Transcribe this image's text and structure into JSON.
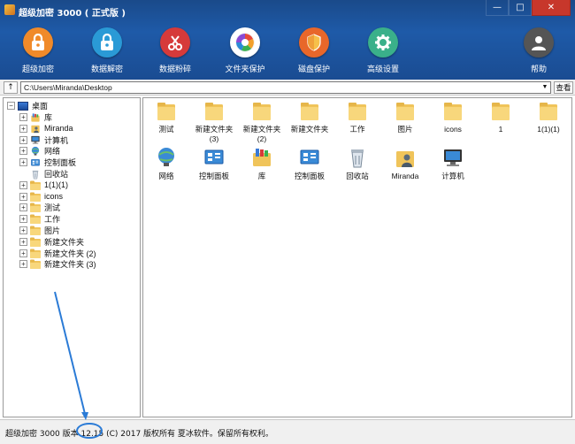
{
  "window": {
    "title": "超级加密 3000 ( 正式版 )",
    "controls": [
      "—",
      "□",
      "✕"
    ]
  },
  "toolbar": {
    "items": [
      {
        "label": "超级加密",
        "icon": "lock-icon",
        "color": "#f08a2a"
      },
      {
        "label": "数据解密",
        "icon": "unlock-icon",
        "color": "#2a9ad6"
      },
      {
        "label": "数据粉碎",
        "icon": "scissors-icon",
        "color": "#d63a3a"
      },
      {
        "label": "文件夹保护",
        "icon": "pinwheel-icon",
        "color": "#ffffff"
      },
      {
        "label": "磁盘保护",
        "icon": "shield-icon",
        "color": "#e8672a"
      },
      {
        "label": "高级设置",
        "icon": "gear-icon",
        "color": "#3ab08a"
      },
      {
        "label": "帮助",
        "icon": "user-icon",
        "color": "#555555"
      }
    ]
  },
  "addressbar": {
    "up_label": "↑",
    "path": "C:\\Users\\Miranda\\Desktop",
    "view_label": "查看"
  },
  "tree": {
    "root": "桌面",
    "items": [
      {
        "label": "库",
        "icon": "library-icon",
        "expandable": true
      },
      {
        "label": "Miranda",
        "icon": "user-folder-icon",
        "expandable": true
      },
      {
        "label": "计算机",
        "icon": "computer-icon",
        "expandable": true
      },
      {
        "label": "网络",
        "icon": "network-icon",
        "expandable": true
      },
      {
        "label": "控制面板",
        "icon": "control-panel-icon",
        "expandable": true
      },
      {
        "label": "回收站",
        "icon": "recycle-bin-icon",
        "expandable": false
      },
      {
        "label": "1(1)(1)",
        "icon": "folder-icon",
        "expandable": true
      },
      {
        "label": "icons",
        "icon": "folder-icon",
        "expandable": true
      },
      {
        "label": "测试",
        "icon": "folder-icon",
        "expandable": true
      },
      {
        "label": "工作",
        "icon": "folder-icon",
        "expandable": true
      },
      {
        "label": "图片",
        "icon": "folder-icon",
        "expandable": true
      },
      {
        "label": "新建文件夹",
        "icon": "folder-icon",
        "expandable": true
      },
      {
        "label": "新建文件夹 (2)",
        "icon": "folder-icon",
        "expandable": true
      },
      {
        "label": "新建文件夹 (3)",
        "icon": "folder-icon",
        "expandable": true
      }
    ]
  },
  "content": {
    "items": [
      {
        "label": "测试",
        "icon": "folder-icon"
      },
      {
        "label": "新建文件夹\n(3)",
        "icon": "folder-icon"
      },
      {
        "label": "新建文件夹\n(2)",
        "icon": "folder-icon"
      },
      {
        "label": "新建文件夹",
        "icon": "folder-icon"
      },
      {
        "label": "工作",
        "icon": "folder-icon"
      },
      {
        "label": "图片",
        "icon": "folder-icon"
      },
      {
        "label": "icons",
        "icon": "folder-icon"
      },
      {
        "label": "1",
        "icon": "folder-icon"
      },
      {
        "label": "1(1)(1)",
        "icon": "folder-icon"
      },
      {
        "label": "网络",
        "icon": "network-icon"
      },
      {
        "label": "控制面板",
        "icon": "control-panel-icon"
      },
      {
        "label": "库",
        "icon": "library-icon"
      },
      {
        "label": "控制面板",
        "icon": "control-panel-icon"
      },
      {
        "label": "回收站",
        "icon": "recycle-bin-icon"
      },
      {
        "label": "Miranda",
        "icon": "user-folder-icon"
      },
      {
        "label": "计算机",
        "icon": "computer-icon"
      }
    ]
  },
  "statusbar": {
    "text": "超级加密 3000  版本 12.15 (C) 2017 版权所有 夏冰软件。保留所有权利。",
    "version": "12.15"
  }
}
